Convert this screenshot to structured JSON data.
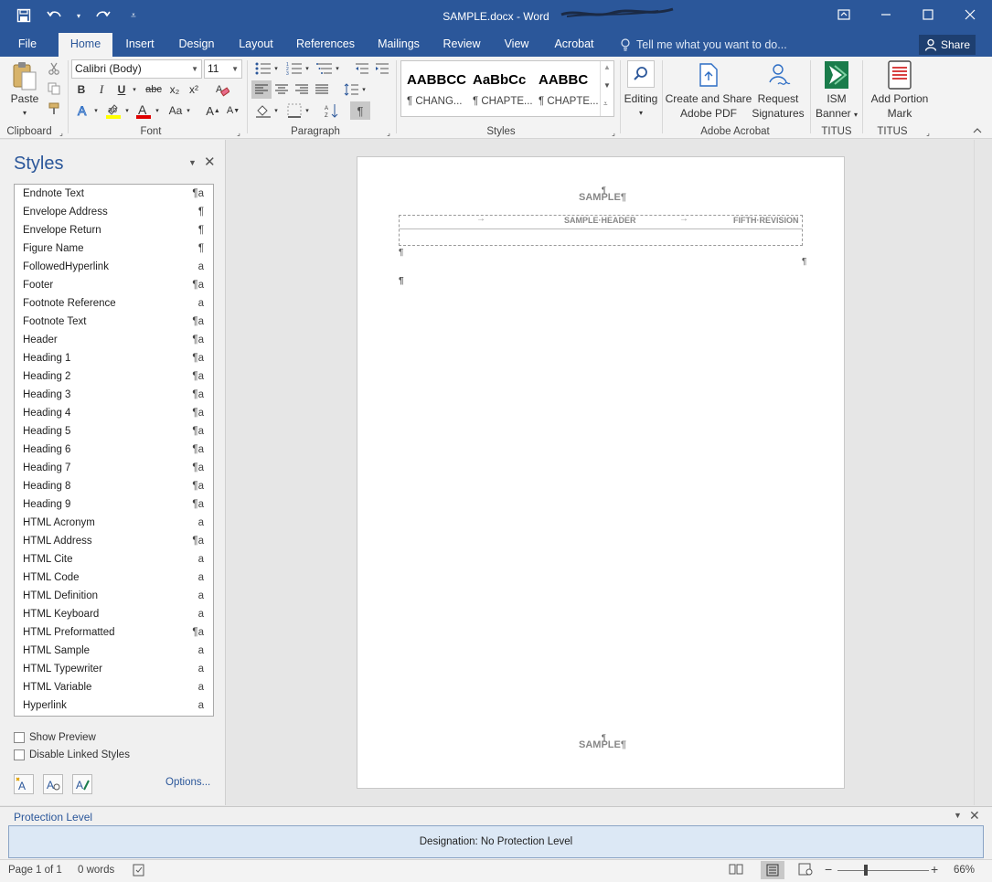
{
  "window": {
    "title": "SAMPLE.docx - Word"
  },
  "tabs": [
    {
      "label": "File"
    },
    {
      "label": "Home"
    },
    {
      "label": "Insert"
    },
    {
      "label": "Design"
    },
    {
      "label": "Layout"
    },
    {
      "label": "References"
    },
    {
      "label": "Mailings"
    },
    {
      "label": "Review"
    },
    {
      "label": "View"
    },
    {
      "label": "Acrobat"
    }
  ],
  "tellme": "Tell me what you want to do...",
  "share": "Share",
  "ribbon": {
    "paste_label": "Paste",
    "font_name": "Calibri (Body)",
    "font_size": "11",
    "bold": "B",
    "italic": "I",
    "underline": "U",
    "strike": "abc",
    "subscript": "x₂",
    "superscript": "x²",
    "change_case": "Aa",
    "grow": "A",
    "shrink": "A",
    "styles": [
      {
        "sample": "AABBCC",
        "name": "¶ CHANG..."
      },
      {
        "sample": "AaBbCc",
        "name": "¶ CHAPTE..."
      },
      {
        "sample": "AABBC",
        "name": "¶ CHAPTE..."
      }
    ],
    "editing_label": "Editing",
    "acrobat_create_line1": "Create and Share",
    "acrobat_create_line2": "Adobe PDF",
    "request_line1": "Request",
    "request_line2": "Signatures",
    "ism_line1": "ISM",
    "ism_line2": "Banner",
    "portion_line1": "Add Portion",
    "portion_line2": "Mark",
    "groups": {
      "clipboard": "Clipboard",
      "font": "Font",
      "paragraph": "Paragraph",
      "styles": "Styles",
      "adobe": "Adobe Acrobat",
      "titus1": "TITUS",
      "titus2": "TITUS"
    }
  },
  "styles_pane": {
    "title": "Styles",
    "items": [
      {
        "name": "Endnote Text",
        "mark": "¶a"
      },
      {
        "name": "Envelope Address",
        "mark": "¶"
      },
      {
        "name": "Envelope Return",
        "mark": "¶"
      },
      {
        "name": "Figure Name",
        "mark": "¶"
      },
      {
        "name": "FollowedHyperlink",
        "mark": "a"
      },
      {
        "name": "Footer",
        "mark": "¶a"
      },
      {
        "name": "Footnote Reference",
        "mark": "a"
      },
      {
        "name": "Footnote Text",
        "mark": "¶a"
      },
      {
        "name": "Header",
        "mark": "¶a"
      },
      {
        "name": "Heading 1",
        "mark": "¶a"
      },
      {
        "name": "Heading 2",
        "mark": "¶a"
      },
      {
        "name": "Heading 3",
        "mark": "¶a"
      },
      {
        "name": "Heading 4",
        "mark": "¶a"
      },
      {
        "name": "Heading 5",
        "mark": "¶a"
      },
      {
        "name": "Heading 6",
        "mark": "¶a"
      },
      {
        "name": "Heading 7",
        "mark": "¶a"
      },
      {
        "name": "Heading 8",
        "mark": "¶a"
      },
      {
        "name": "Heading 9",
        "mark": "¶a"
      },
      {
        "name": "HTML Acronym",
        "mark": "a"
      },
      {
        "name": "HTML Address",
        "mark": "¶a"
      },
      {
        "name": "HTML Cite",
        "mark": "a"
      },
      {
        "name": "HTML Code",
        "mark": "a"
      },
      {
        "name": "HTML Definition",
        "mark": "a"
      },
      {
        "name": "HTML Keyboard",
        "mark": "a"
      },
      {
        "name": "HTML Preformatted",
        "mark": "¶a"
      },
      {
        "name": "HTML Sample",
        "mark": "a"
      },
      {
        "name": "HTML Typewriter",
        "mark": "a"
      },
      {
        "name": "HTML Variable",
        "mark": "a"
      },
      {
        "name": "Hyperlink",
        "mark": "a"
      }
    ],
    "show_preview": "Show Preview",
    "disable_linked": "Disable Linked Styles",
    "options": "Options..."
  },
  "document": {
    "top_marking": "SAMPLE¶",
    "header_left": "SAMPLE·HEADER",
    "header_right": "FIFTH·REVISION",
    "bottom_marking": "SAMPLE¶",
    "pilcrow": "¶"
  },
  "protection": {
    "title": "Protection Level",
    "designation": "Designation: No Protection Level"
  },
  "status": {
    "page": "Page 1 of 1",
    "words": "0 words",
    "zoom": "66%"
  },
  "colors": {
    "word_blue": "#2b579a",
    "ribbon_bg": "#f3f3f3",
    "protection_box": "#dce8f5"
  }
}
